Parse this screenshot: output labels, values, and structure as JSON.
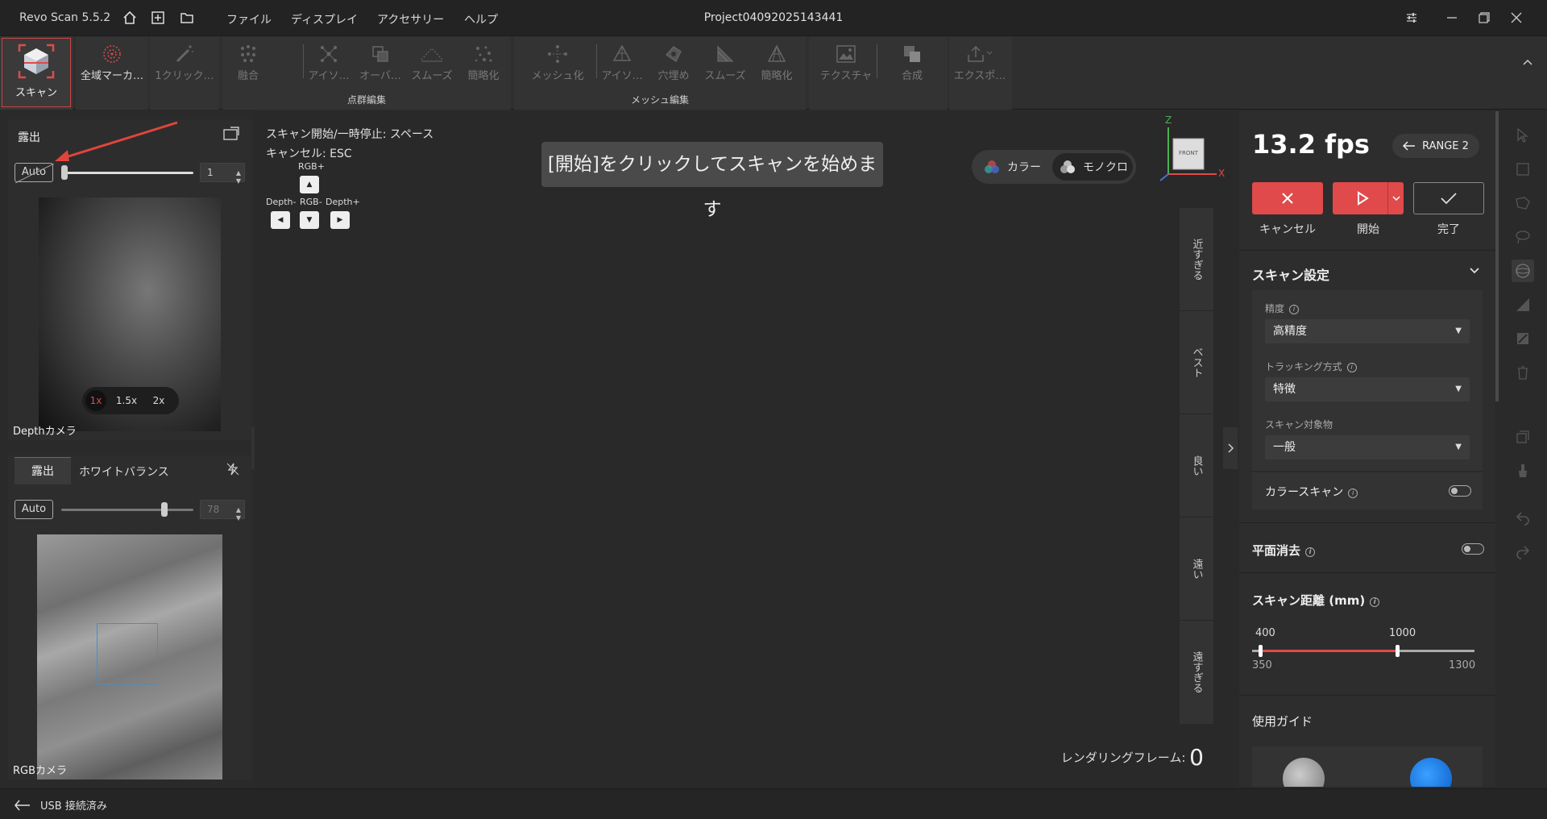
{
  "app": {
    "name": "Revo Scan 5.5.2",
    "project": "Project04092025143441",
    "menus": [
      "ファイル",
      "ディスプレイ",
      "アクセサリー",
      "ヘルプ"
    ]
  },
  "toolbar": {
    "scan": "スキャン",
    "global_marker": "全域マーカ…",
    "one_click": "1クリック…",
    "pointcloud": {
      "group_label": "点群編集",
      "fuse": "融合",
      "isolate": "アイソ…",
      "overlap": "オーバ…",
      "smooth": "スムーズ",
      "simplify": "簡略化"
    },
    "mesh": {
      "group_label": "メッシュ編集",
      "meshing": "メッシュ化",
      "isolate": "アイソ…",
      "fill_holes": "穴埋め",
      "smooth": "スムーズ",
      "simplify": "簡略化"
    },
    "texture": "テクスチャ",
    "merge": "合成",
    "export": "エクスポ…"
  },
  "depth_panel": {
    "title": "露出",
    "auto_label": "Auto",
    "value": "1",
    "camera_label": "Depthカメラ",
    "zoom_options": [
      "1x",
      "1.5x",
      "2x"
    ],
    "zoom_selected": "1x"
  },
  "rgb_panel": {
    "tab_exposure": "露出",
    "tab_white_balance": "ホワイトバランス",
    "auto_label": "Auto",
    "value": "78",
    "value_fraction": 0.78,
    "camera_label": "RGBカメラ"
  },
  "viewport": {
    "hint_start": "スキャン開始/一時停止:  スペース",
    "hint_cancel": "キャンセル:  ESC",
    "key_rgb_plus": "RGB+",
    "key_depth_minus": "Depth-",
    "key_rgb_minus": "RGB-",
    "key_depth_plus": "Depth+",
    "start_banner": "[開始]をクリックしてスキャンを始めます",
    "mode_color": "カラー",
    "mode_mono": "モノクロ",
    "axis_z": "Z",
    "axis_x": "X",
    "cube_face": "FRONT",
    "distance_labels": [
      "近すぎる",
      "ベスト",
      "良い",
      "遠い",
      "遠すぎる"
    ],
    "render_frame_label": "レンダリングフレーム:",
    "render_frame_value": "0"
  },
  "right_panel": {
    "fps": "13.2 fps",
    "range_label": "RANGE 2",
    "cancel_label": "キャンセル",
    "start_label": "開始",
    "done_label": "完了",
    "scan_settings_title": "スキャン設定",
    "precision_label": "精度",
    "precision_value": "高精度",
    "tracking_label": "トラッキング方式",
    "tracking_value": "特徴",
    "object_label": "スキャン対象物",
    "object_value": "一般",
    "color_scan_label": "カラースキャン",
    "plane_removal_label": "平面消去",
    "scan_distance_title": "スキャン距離 (mm)",
    "distance_low": "400",
    "distance_high": "1000",
    "distance_min": "350",
    "distance_max": "1300",
    "guide_title": "使用ガイド"
  },
  "statusbar": {
    "usb_status": "USB 接続済み"
  },
  "colors": {
    "accent_red": "#e04a4a",
    "panel_bg": "#2d2d2d"
  }
}
